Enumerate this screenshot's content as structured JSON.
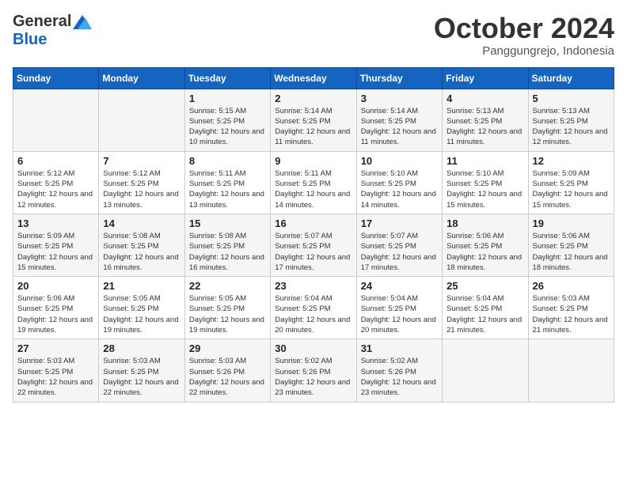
{
  "header": {
    "logo_general": "General",
    "logo_blue": "Blue",
    "month": "October 2024",
    "location": "Panggungrejo, Indonesia"
  },
  "days_of_week": [
    "Sunday",
    "Monday",
    "Tuesday",
    "Wednesday",
    "Thursday",
    "Friday",
    "Saturday"
  ],
  "weeks": [
    [
      {
        "day": "",
        "info": ""
      },
      {
        "day": "",
        "info": ""
      },
      {
        "day": "1",
        "info": "Sunrise: 5:15 AM\nSunset: 5:25 PM\nDaylight: 12 hours and 10 minutes."
      },
      {
        "day": "2",
        "info": "Sunrise: 5:14 AM\nSunset: 5:25 PM\nDaylight: 12 hours and 11 minutes."
      },
      {
        "day": "3",
        "info": "Sunrise: 5:14 AM\nSunset: 5:25 PM\nDaylight: 12 hours and 11 minutes."
      },
      {
        "day": "4",
        "info": "Sunrise: 5:13 AM\nSunset: 5:25 PM\nDaylight: 12 hours and 11 minutes."
      },
      {
        "day": "5",
        "info": "Sunrise: 5:13 AM\nSunset: 5:25 PM\nDaylight: 12 hours and 12 minutes."
      }
    ],
    [
      {
        "day": "6",
        "info": "Sunrise: 5:12 AM\nSunset: 5:25 PM\nDaylight: 12 hours and 12 minutes."
      },
      {
        "day": "7",
        "info": "Sunrise: 5:12 AM\nSunset: 5:25 PM\nDaylight: 12 hours and 13 minutes."
      },
      {
        "day": "8",
        "info": "Sunrise: 5:11 AM\nSunset: 5:25 PM\nDaylight: 12 hours and 13 minutes."
      },
      {
        "day": "9",
        "info": "Sunrise: 5:11 AM\nSunset: 5:25 PM\nDaylight: 12 hours and 14 minutes."
      },
      {
        "day": "10",
        "info": "Sunrise: 5:10 AM\nSunset: 5:25 PM\nDaylight: 12 hours and 14 minutes."
      },
      {
        "day": "11",
        "info": "Sunrise: 5:10 AM\nSunset: 5:25 PM\nDaylight: 12 hours and 15 minutes."
      },
      {
        "day": "12",
        "info": "Sunrise: 5:09 AM\nSunset: 5:25 PM\nDaylight: 12 hours and 15 minutes."
      }
    ],
    [
      {
        "day": "13",
        "info": "Sunrise: 5:09 AM\nSunset: 5:25 PM\nDaylight: 12 hours and 15 minutes."
      },
      {
        "day": "14",
        "info": "Sunrise: 5:08 AM\nSunset: 5:25 PM\nDaylight: 12 hours and 16 minutes."
      },
      {
        "day": "15",
        "info": "Sunrise: 5:08 AM\nSunset: 5:25 PM\nDaylight: 12 hours and 16 minutes."
      },
      {
        "day": "16",
        "info": "Sunrise: 5:07 AM\nSunset: 5:25 PM\nDaylight: 12 hours and 17 minutes."
      },
      {
        "day": "17",
        "info": "Sunrise: 5:07 AM\nSunset: 5:25 PM\nDaylight: 12 hours and 17 minutes."
      },
      {
        "day": "18",
        "info": "Sunrise: 5:06 AM\nSunset: 5:25 PM\nDaylight: 12 hours and 18 minutes."
      },
      {
        "day": "19",
        "info": "Sunrise: 5:06 AM\nSunset: 5:25 PM\nDaylight: 12 hours and 18 minutes."
      }
    ],
    [
      {
        "day": "20",
        "info": "Sunrise: 5:06 AM\nSunset: 5:25 PM\nDaylight: 12 hours and 19 minutes."
      },
      {
        "day": "21",
        "info": "Sunrise: 5:05 AM\nSunset: 5:25 PM\nDaylight: 12 hours and 19 minutes."
      },
      {
        "day": "22",
        "info": "Sunrise: 5:05 AM\nSunset: 5:25 PM\nDaylight: 12 hours and 19 minutes."
      },
      {
        "day": "23",
        "info": "Sunrise: 5:04 AM\nSunset: 5:25 PM\nDaylight: 12 hours and 20 minutes."
      },
      {
        "day": "24",
        "info": "Sunrise: 5:04 AM\nSunset: 5:25 PM\nDaylight: 12 hours and 20 minutes."
      },
      {
        "day": "25",
        "info": "Sunrise: 5:04 AM\nSunset: 5:25 PM\nDaylight: 12 hours and 21 minutes."
      },
      {
        "day": "26",
        "info": "Sunrise: 5:03 AM\nSunset: 5:25 PM\nDaylight: 12 hours and 21 minutes."
      }
    ],
    [
      {
        "day": "27",
        "info": "Sunrise: 5:03 AM\nSunset: 5:25 PM\nDaylight: 12 hours and 22 minutes."
      },
      {
        "day": "28",
        "info": "Sunrise: 5:03 AM\nSunset: 5:25 PM\nDaylight: 12 hours and 22 minutes."
      },
      {
        "day": "29",
        "info": "Sunrise: 5:03 AM\nSunset: 5:26 PM\nDaylight: 12 hours and 22 minutes."
      },
      {
        "day": "30",
        "info": "Sunrise: 5:02 AM\nSunset: 5:26 PM\nDaylight: 12 hours and 23 minutes."
      },
      {
        "day": "31",
        "info": "Sunrise: 5:02 AM\nSunset: 5:26 PM\nDaylight: 12 hours and 23 minutes."
      },
      {
        "day": "",
        "info": ""
      },
      {
        "day": "",
        "info": ""
      }
    ]
  ]
}
